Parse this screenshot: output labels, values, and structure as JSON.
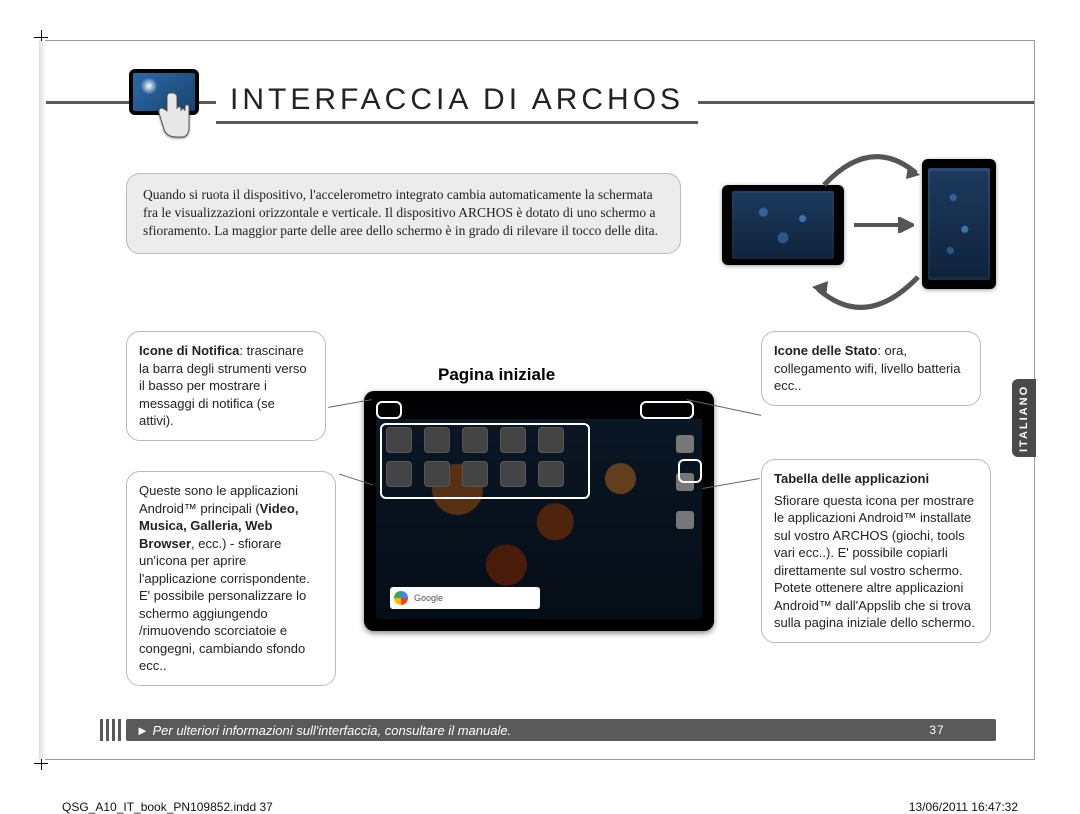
{
  "header": {
    "title": "INTERFACCIA DI ARCHOS"
  },
  "intro": "Quando si ruota il dispositivo, l'accelerometro integrato cambia automaticamente la schermata fra le visualizzazioni orizzontale e verticale. Il dispositivo ARCHOS è dotato di uno schermo a sfioramento. La maggior parte delle aree dello schermo è in grado di rilevare il tocco delle dita.",
  "home_title": "Pagina iniziale",
  "callouts": {
    "notify": {
      "bold": "Icone di Notifica",
      "text": ": trascinare la barra degli strumenti verso il basso per mostrare i messaggi di notifica (se attivi)."
    },
    "apps": {
      "pre": "Queste sono le applicazioni Android™ principali (",
      "bold": "Video, Musica, Galleria, Web Browser",
      "post": ", ecc.) - sfiorare un'icona per aprire l'applicazione corrispondente. E' possibile personalizzare lo schermo aggiungendo /rimuovendo scorciatoie e congegni, cambiando sfondo ecc.."
    },
    "state": {
      "bold": "Icone delle Stato",
      "text": ": ora, collegamento wifi, livello batteria ecc.."
    },
    "table": {
      "title": "Tabella delle applicazioni",
      "text": "Sfiorare questa icona per mostrare le applicazioni Android™ installate sul vostro ARCHOS (giochi, tools vari ecc..). E' possibile copiarli direttamente sul vostro schermo. Potete ottenere altre applicazioni Android™ dall'Appslib che si trova sulla pagina iniziale dello schermo."
    }
  },
  "search_placeholder": "Google",
  "language_tab": "ITALIANO",
  "footer_note": "► Per ulteriori informazioni sull'interfaccia, consultare il manuale.",
  "page_number": "37",
  "print": {
    "left": "QSG_A10_IT_book_PN109852.indd   37",
    "right": "13/06/2011   16:47:32"
  }
}
